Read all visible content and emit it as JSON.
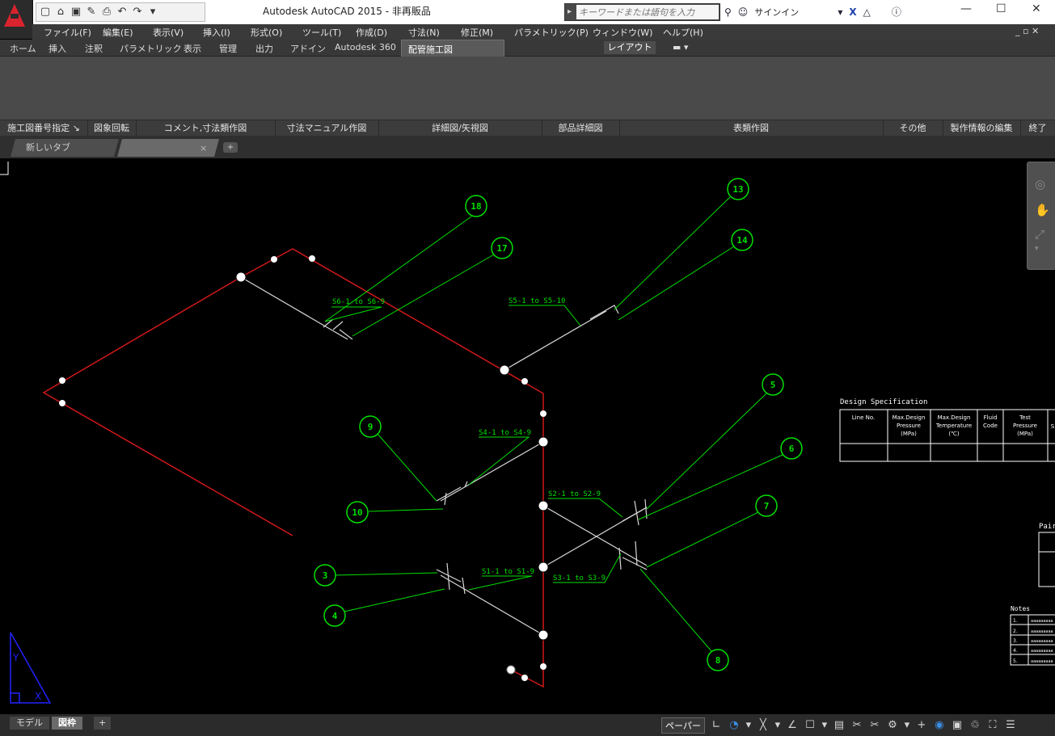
{
  "window": {
    "title": "Autodesk AutoCAD 2015 - 非再販品",
    "search_placeholder": "キーワードまたは語句を入力",
    "signin": "サインイン"
  },
  "menu": [
    "ファイル(F)",
    "編集(E)",
    "表示(V)",
    "挿入(I)",
    "形式(O)",
    "ツール(T)",
    "作成(D)",
    "寸法(N)",
    "修正(M)",
    "パラメトリック(P)",
    "ウィンドウ(W)",
    "ヘルプ(H)"
  ],
  "ribbon_tabs": [
    "ホーム",
    "挿入",
    "注釈",
    "パラメトリック",
    "表示",
    "管理",
    "出力",
    "アドイン",
    "Autodesk 360",
    "配管施工図"
  ],
  "layout_tab": "レイアウト",
  "panels": [
    "施工図番号指定 ↘",
    "図象回転",
    "コメント,寸法類作図",
    "寸法マニュアル作図",
    "詳細図/矢視図",
    "部品詳細図",
    "表類作図",
    "その他",
    "製作情報の編集",
    "終了"
  ],
  "file_tabs": {
    "new_tab": "新しいタブ",
    "close": "×",
    "add": "+"
  },
  "drawing": {
    "balloons": [
      "18",
      "17",
      "13",
      "14",
      "5",
      "6",
      "7",
      "9",
      "10",
      "3",
      "4",
      "8"
    ],
    "spool_labels": [
      "S6-1 to S6-9",
      "S5-1 to S5-10",
      "S4-1 to S4-9",
      "S2-1 to S2-9",
      "S1-1 to S1-9",
      "S3-1 to S3-9"
    ],
    "design_spec": {
      "title": "Design Specification",
      "headers": [
        "Line No.",
        "Max.Design\nPressure\n(MPa)",
        "Max.Design\nTemperature\n(℃)",
        "Fluid\nCode",
        "Test\nPressure\n(MPa)",
        "S"
      ]
    },
    "paint_label": "Pair",
    "notes": {
      "title": "Notes",
      "rows": [
        "1.",
        "2.",
        "3.",
        "4.",
        "5."
      ],
      "filler": "aaaaaaaaa"
    },
    "ucs": {
      "y": "Y",
      "x": "X"
    }
  },
  "layout_tabs": [
    "モデル",
    "図枠",
    "+"
  ],
  "status": {
    "paper": "ペーパー"
  },
  "colors": {
    "pipe_red": "#d01818",
    "leader_green": "#00e000",
    "pipe_white": "#d8d8d8",
    "ucs_blue": "#2222ff"
  }
}
